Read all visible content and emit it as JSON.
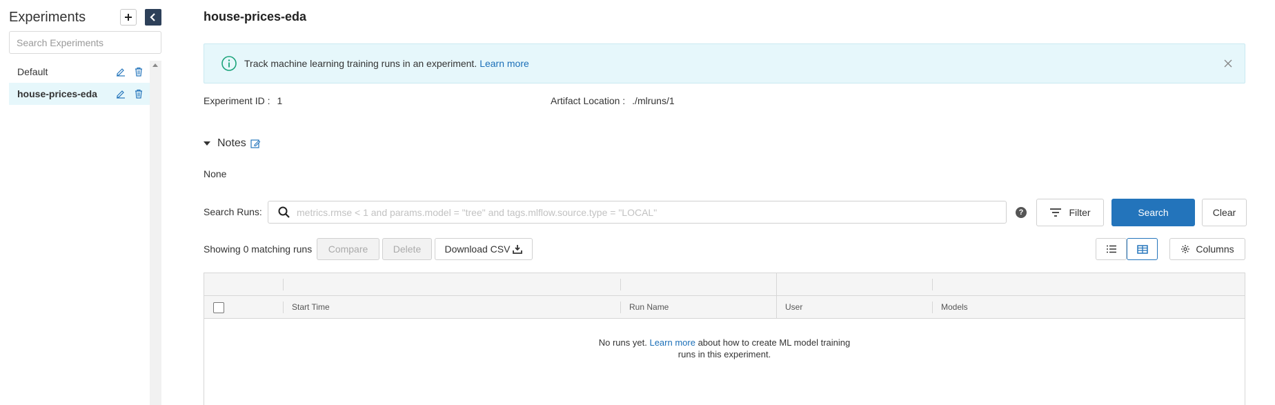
{
  "sidebar": {
    "title": "Experiments",
    "search_placeholder": "Search Experiments",
    "items": [
      {
        "label": "Default",
        "active": false
      },
      {
        "label": "house-prices-eda",
        "active": true
      }
    ]
  },
  "main": {
    "title": "house-prices-eda",
    "banner": {
      "text": "Track machine learning training runs in an experiment.",
      "link": "Learn more"
    },
    "experiment_id_label": "Experiment ID :",
    "experiment_id": "1",
    "artifact_label": "Artifact Location :",
    "artifact_value": "./mlruns/1",
    "notes_label": "Notes",
    "notes_value": "None",
    "search": {
      "label": "Search Runs:",
      "placeholder": "metrics.rmse < 1 and params.model = \"tree\" and tags.mlflow.source.type = \"LOCAL\"",
      "filter_label": "Filter",
      "search_label": "Search",
      "clear_label": "Clear"
    },
    "toolbar": {
      "showing": "Showing 0 matching runs",
      "compare": "Compare",
      "delete": "Delete",
      "download_csv": "Download CSV",
      "columns": "Columns"
    },
    "table": {
      "headers": [
        "Start Time",
        "Run Name",
        "User",
        "Models"
      ],
      "empty_prefix": "No runs yet.",
      "empty_link": "Learn more",
      "empty_line1_suffix": "about how to create ML model training",
      "empty_line2": "runs in this experiment."
    }
  },
  "colors": {
    "primary": "#2374bb",
    "banner_bg": "#e6f7fb",
    "info_icon": "#1aa37a",
    "link": "#1b6fb8",
    "sidebar_collapse": "#2d4059"
  },
  "icons": [
    "plus-icon",
    "chevron-left-icon",
    "edit-icon",
    "trash-icon",
    "info-icon",
    "close-icon",
    "search-icon",
    "help-icon",
    "filter-icon",
    "download-icon",
    "list-view-icon",
    "table-view-icon",
    "gear-icon"
  ]
}
